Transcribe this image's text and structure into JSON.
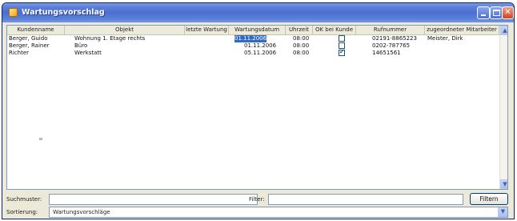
{
  "window": {
    "title": "Wartungsvorschlag"
  },
  "grid": {
    "columns": [
      "Kundenname",
      "Objekt",
      "letzte Wartung",
      "Wartungsdatum",
      "Uhrzeit",
      "OK bei Kunde",
      "Rufnummer",
      "zugeordneter Mitarbeiter"
    ],
    "rows": [
      {
        "kundenname": "Berger, Guido",
        "objekt": "Wohnung 1. Etage rechts",
        "letzte_wartung": "",
        "wartungsdatum": "01.11.2006",
        "uhrzeit": "08:00",
        "ok_bei_kunde": false,
        "rufnummer": "02191-8865223",
        "mitarbeiter": "Meister, Dirk"
      },
      {
        "kundenname": "Berger, Rainer",
        "objekt": "Büro",
        "letzte_wartung": "",
        "wartungsdatum": "01.11.2006",
        "uhrzeit": "08:00",
        "ok_bei_kunde": false,
        "rufnummer": "0202-787765",
        "mitarbeiter": ""
      },
      {
        "kundenname": "Richter",
        "objekt": "Werkstatt",
        "letzte_wartung": "",
        "wartungsdatum": "05.11.2006",
        "uhrzeit": "08:00",
        "ok_bei_kunde": true,
        "rufnummer": "14651561",
        "mitarbeiter": ""
      }
    ],
    "selected_cell": "01.11.2006"
  },
  "footer": {
    "suchmuster_label": "Suchmuster:",
    "suchmuster_value": "",
    "filter_label": "Filter:",
    "filter_value": "",
    "filtern_button": "Filtern",
    "sortierung_label": "Sortierung:",
    "sortierung_value": "Wartungsvorschläge"
  },
  "colors": {
    "titlebar": "#4a6fd0",
    "selection": "#316ac5",
    "window_bg": "#ece9d8"
  }
}
